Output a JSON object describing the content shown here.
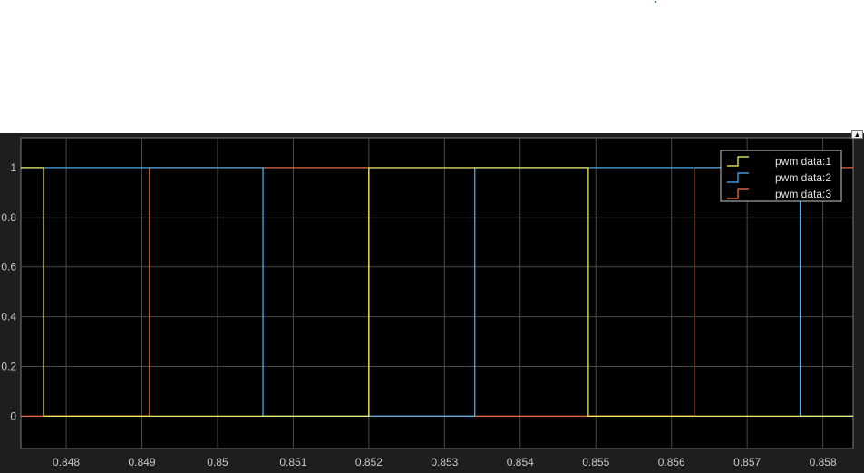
{
  "chart_data": {
    "type": "line",
    "xlim": [
      0.8474,
      0.8584
    ],
    "ylim": [
      -0.13,
      1.12
    ],
    "x_ticks": [
      0.848,
      0.849,
      0.85,
      0.851,
      0.852,
      0.853,
      0.854,
      0.855,
      0.856,
      0.857,
      0.858
    ],
    "x_tick_labels": [
      "0.848",
      "0.849",
      "0.85",
      "0.851",
      "0.852",
      "0.853",
      "0.854",
      "0.855",
      "0.856",
      "0.857",
      "0.858"
    ],
    "y_ticks": [
      0,
      0.2,
      0.4,
      0.6,
      0.8,
      1
    ],
    "y_tick_labels": [
      "0",
      "0.2",
      "0.4",
      "0.6",
      "0.8",
      "1"
    ],
    "grid": true,
    "legend_position": "top-right",
    "series": [
      {
        "name": "pwm data:1",
        "color": "#ffff66",
        "x": [
          0.8474,
          0.8477,
          0.8477,
          0.852,
          0.852,
          0.8549,
          0.8549,
          0.8584
        ],
        "y": [
          1,
          1,
          0,
          0,
          1,
          1,
          0,
          0
        ]
      },
      {
        "name": "pwm data:2",
        "color": "#4db8ff",
        "x": [
          0.8474,
          0.8506,
          0.8506,
          0.8534,
          0.8534,
          0.8577,
          0.8577,
          0.8584
        ],
        "y": [
          1,
          1,
          0,
          0,
          1,
          1,
          0,
          0
        ]
      },
      {
        "name": "pwm data:3",
        "color": "#ff7043",
        "x": [
          0.8474,
          0.8491,
          0.8491,
          0.852,
          0.852,
          0.8563,
          0.8563,
          0.8584
        ],
        "y": [
          0,
          0,
          1,
          1,
          0,
          0,
          1,
          1
        ]
      }
    ]
  },
  "ui": {
    "expand_icon_glyph": "▲",
    "grid_color": "#4a4a4a",
    "axes_background": "#000000",
    "panel_background": "#1e1e1e"
  }
}
